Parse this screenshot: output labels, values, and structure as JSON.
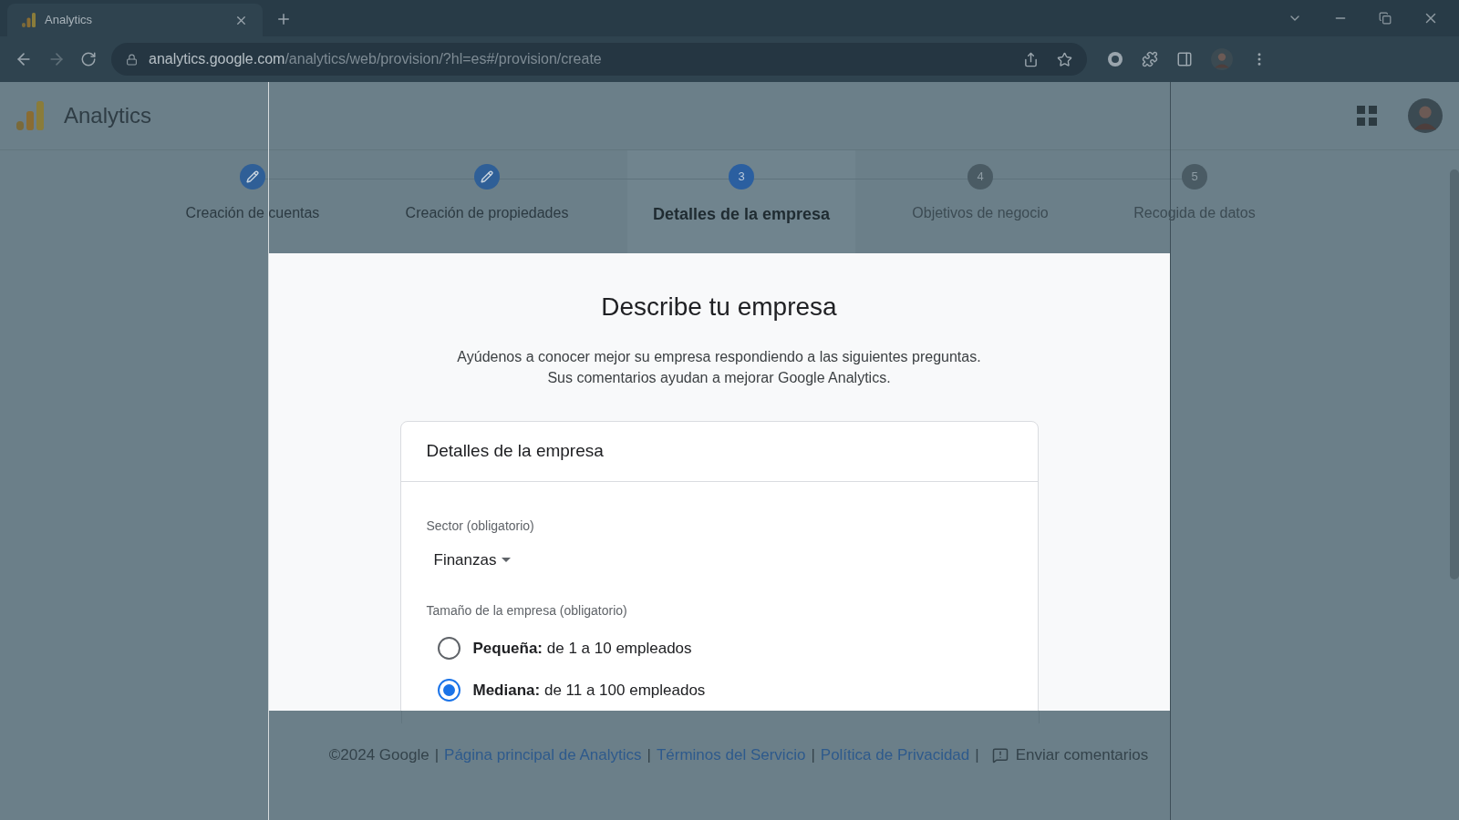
{
  "browser": {
    "tab_title": "Analytics",
    "url_host": "analytics.google.com",
    "url_path": "/analytics/web/provision/?hl=es#/provision/create"
  },
  "header": {
    "product": "Analytics"
  },
  "steps": [
    {
      "label": "Creación de cuentas",
      "kind": "done"
    },
    {
      "label": "Creación de propiedades",
      "kind": "done"
    },
    {
      "number": "3",
      "label": "Detalles de la empresa",
      "kind": "current"
    },
    {
      "number": "4",
      "label": "Objetivos de negocio",
      "kind": "pending"
    },
    {
      "number": "5",
      "label": "Recogida de datos",
      "kind": "pending"
    }
  ],
  "page": {
    "title": "Describe tu empresa",
    "intro": [
      "Ayúdenos a conocer mejor su empresa respondiendo a las siguientes preguntas.",
      "Sus comentarios ayudan a mejorar Google Analytics."
    ]
  },
  "card": {
    "title": "Detalles de la empresa",
    "sector_label": "Sector (obligatorio)",
    "sector_value": "Finanzas",
    "size_label": "Tamaño de la empresa (obligatorio)",
    "sizes": [
      {
        "name": "Pequeña:",
        "range": "de 1 a 10 empleados",
        "selected": false
      },
      {
        "name": "Mediana:",
        "range": "de 11 a 100 empleados",
        "selected": true
      }
    ]
  },
  "footer": {
    "copyright": "©2024 Google",
    "separator": "|",
    "links": [
      "Página principal de Analytics",
      "Términos del Servicio",
      "Política de Privacidad"
    ],
    "feedback": "Enviar comentarios"
  }
}
